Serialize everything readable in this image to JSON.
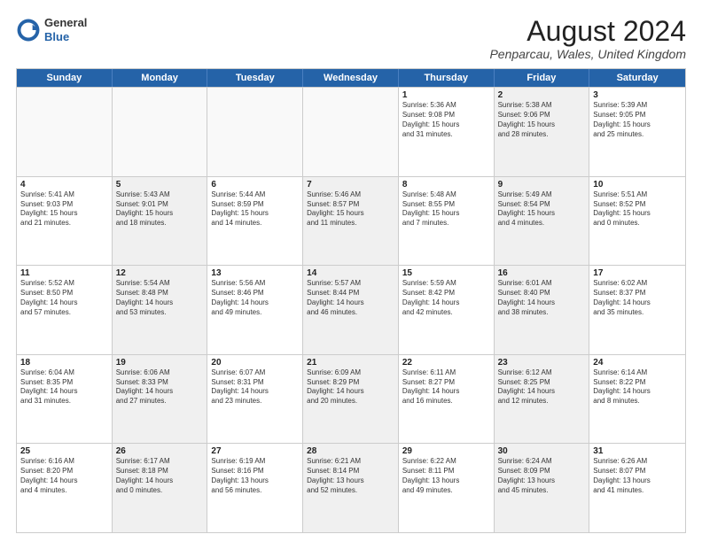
{
  "header": {
    "logo_general": "General",
    "logo_blue": "Blue",
    "month_title": "August 2024",
    "location": "Penparcau, Wales, United Kingdom"
  },
  "weekdays": [
    "Sunday",
    "Monday",
    "Tuesday",
    "Wednesday",
    "Thursday",
    "Friday",
    "Saturday"
  ],
  "weeks": [
    [
      {
        "day": "",
        "text": "",
        "shaded": false,
        "empty": true
      },
      {
        "day": "",
        "text": "",
        "shaded": false,
        "empty": true
      },
      {
        "day": "",
        "text": "",
        "shaded": false,
        "empty": true
      },
      {
        "day": "",
        "text": "",
        "shaded": false,
        "empty": true
      },
      {
        "day": "1",
        "text": "Sunrise: 5:36 AM\nSunset: 9:08 PM\nDaylight: 15 hours\nand 31 minutes.",
        "shaded": false,
        "empty": false
      },
      {
        "day": "2",
        "text": "Sunrise: 5:38 AM\nSunset: 9:06 PM\nDaylight: 15 hours\nand 28 minutes.",
        "shaded": true,
        "empty": false
      },
      {
        "day": "3",
        "text": "Sunrise: 5:39 AM\nSunset: 9:05 PM\nDaylight: 15 hours\nand 25 minutes.",
        "shaded": false,
        "empty": false
      }
    ],
    [
      {
        "day": "4",
        "text": "Sunrise: 5:41 AM\nSunset: 9:03 PM\nDaylight: 15 hours\nand 21 minutes.",
        "shaded": false,
        "empty": false
      },
      {
        "day": "5",
        "text": "Sunrise: 5:43 AM\nSunset: 9:01 PM\nDaylight: 15 hours\nand 18 minutes.",
        "shaded": true,
        "empty": false
      },
      {
        "day": "6",
        "text": "Sunrise: 5:44 AM\nSunset: 8:59 PM\nDaylight: 15 hours\nand 14 minutes.",
        "shaded": false,
        "empty": false
      },
      {
        "day": "7",
        "text": "Sunrise: 5:46 AM\nSunset: 8:57 PM\nDaylight: 15 hours\nand 11 minutes.",
        "shaded": true,
        "empty": false
      },
      {
        "day": "8",
        "text": "Sunrise: 5:48 AM\nSunset: 8:55 PM\nDaylight: 15 hours\nand 7 minutes.",
        "shaded": false,
        "empty": false
      },
      {
        "day": "9",
        "text": "Sunrise: 5:49 AM\nSunset: 8:54 PM\nDaylight: 15 hours\nand 4 minutes.",
        "shaded": true,
        "empty": false
      },
      {
        "day": "10",
        "text": "Sunrise: 5:51 AM\nSunset: 8:52 PM\nDaylight: 15 hours\nand 0 minutes.",
        "shaded": false,
        "empty": false
      }
    ],
    [
      {
        "day": "11",
        "text": "Sunrise: 5:52 AM\nSunset: 8:50 PM\nDaylight: 14 hours\nand 57 minutes.",
        "shaded": false,
        "empty": false
      },
      {
        "day": "12",
        "text": "Sunrise: 5:54 AM\nSunset: 8:48 PM\nDaylight: 14 hours\nand 53 minutes.",
        "shaded": true,
        "empty": false
      },
      {
        "day": "13",
        "text": "Sunrise: 5:56 AM\nSunset: 8:46 PM\nDaylight: 14 hours\nand 49 minutes.",
        "shaded": false,
        "empty": false
      },
      {
        "day": "14",
        "text": "Sunrise: 5:57 AM\nSunset: 8:44 PM\nDaylight: 14 hours\nand 46 minutes.",
        "shaded": true,
        "empty": false
      },
      {
        "day": "15",
        "text": "Sunrise: 5:59 AM\nSunset: 8:42 PM\nDaylight: 14 hours\nand 42 minutes.",
        "shaded": false,
        "empty": false
      },
      {
        "day": "16",
        "text": "Sunrise: 6:01 AM\nSunset: 8:40 PM\nDaylight: 14 hours\nand 38 minutes.",
        "shaded": true,
        "empty": false
      },
      {
        "day": "17",
        "text": "Sunrise: 6:02 AM\nSunset: 8:37 PM\nDaylight: 14 hours\nand 35 minutes.",
        "shaded": false,
        "empty": false
      }
    ],
    [
      {
        "day": "18",
        "text": "Sunrise: 6:04 AM\nSunset: 8:35 PM\nDaylight: 14 hours\nand 31 minutes.",
        "shaded": false,
        "empty": false
      },
      {
        "day": "19",
        "text": "Sunrise: 6:06 AM\nSunset: 8:33 PM\nDaylight: 14 hours\nand 27 minutes.",
        "shaded": true,
        "empty": false
      },
      {
        "day": "20",
        "text": "Sunrise: 6:07 AM\nSunset: 8:31 PM\nDaylight: 14 hours\nand 23 minutes.",
        "shaded": false,
        "empty": false
      },
      {
        "day": "21",
        "text": "Sunrise: 6:09 AM\nSunset: 8:29 PM\nDaylight: 14 hours\nand 20 minutes.",
        "shaded": true,
        "empty": false
      },
      {
        "day": "22",
        "text": "Sunrise: 6:11 AM\nSunset: 8:27 PM\nDaylight: 14 hours\nand 16 minutes.",
        "shaded": false,
        "empty": false
      },
      {
        "day": "23",
        "text": "Sunrise: 6:12 AM\nSunset: 8:25 PM\nDaylight: 14 hours\nand 12 minutes.",
        "shaded": true,
        "empty": false
      },
      {
        "day": "24",
        "text": "Sunrise: 6:14 AM\nSunset: 8:22 PM\nDaylight: 14 hours\nand 8 minutes.",
        "shaded": false,
        "empty": false
      }
    ],
    [
      {
        "day": "25",
        "text": "Sunrise: 6:16 AM\nSunset: 8:20 PM\nDaylight: 14 hours\nand 4 minutes.",
        "shaded": false,
        "empty": false
      },
      {
        "day": "26",
        "text": "Sunrise: 6:17 AM\nSunset: 8:18 PM\nDaylight: 14 hours\nand 0 minutes.",
        "shaded": true,
        "empty": false
      },
      {
        "day": "27",
        "text": "Sunrise: 6:19 AM\nSunset: 8:16 PM\nDaylight: 13 hours\nand 56 minutes.",
        "shaded": false,
        "empty": false
      },
      {
        "day": "28",
        "text": "Sunrise: 6:21 AM\nSunset: 8:14 PM\nDaylight: 13 hours\nand 52 minutes.",
        "shaded": true,
        "empty": false
      },
      {
        "day": "29",
        "text": "Sunrise: 6:22 AM\nSunset: 8:11 PM\nDaylight: 13 hours\nand 49 minutes.",
        "shaded": false,
        "empty": false
      },
      {
        "day": "30",
        "text": "Sunrise: 6:24 AM\nSunset: 8:09 PM\nDaylight: 13 hours\nand 45 minutes.",
        "shaded": true,
        "empty": false
      },
      {
        "day": "31",
        "text": "Sunrise: 6:26 AM\nSunset: 8:07 PM\nDaylight: 13 hours\nand 41 minutes.",
        "shaded": false,
        "empty": false
      }
    ]
  ]
}
